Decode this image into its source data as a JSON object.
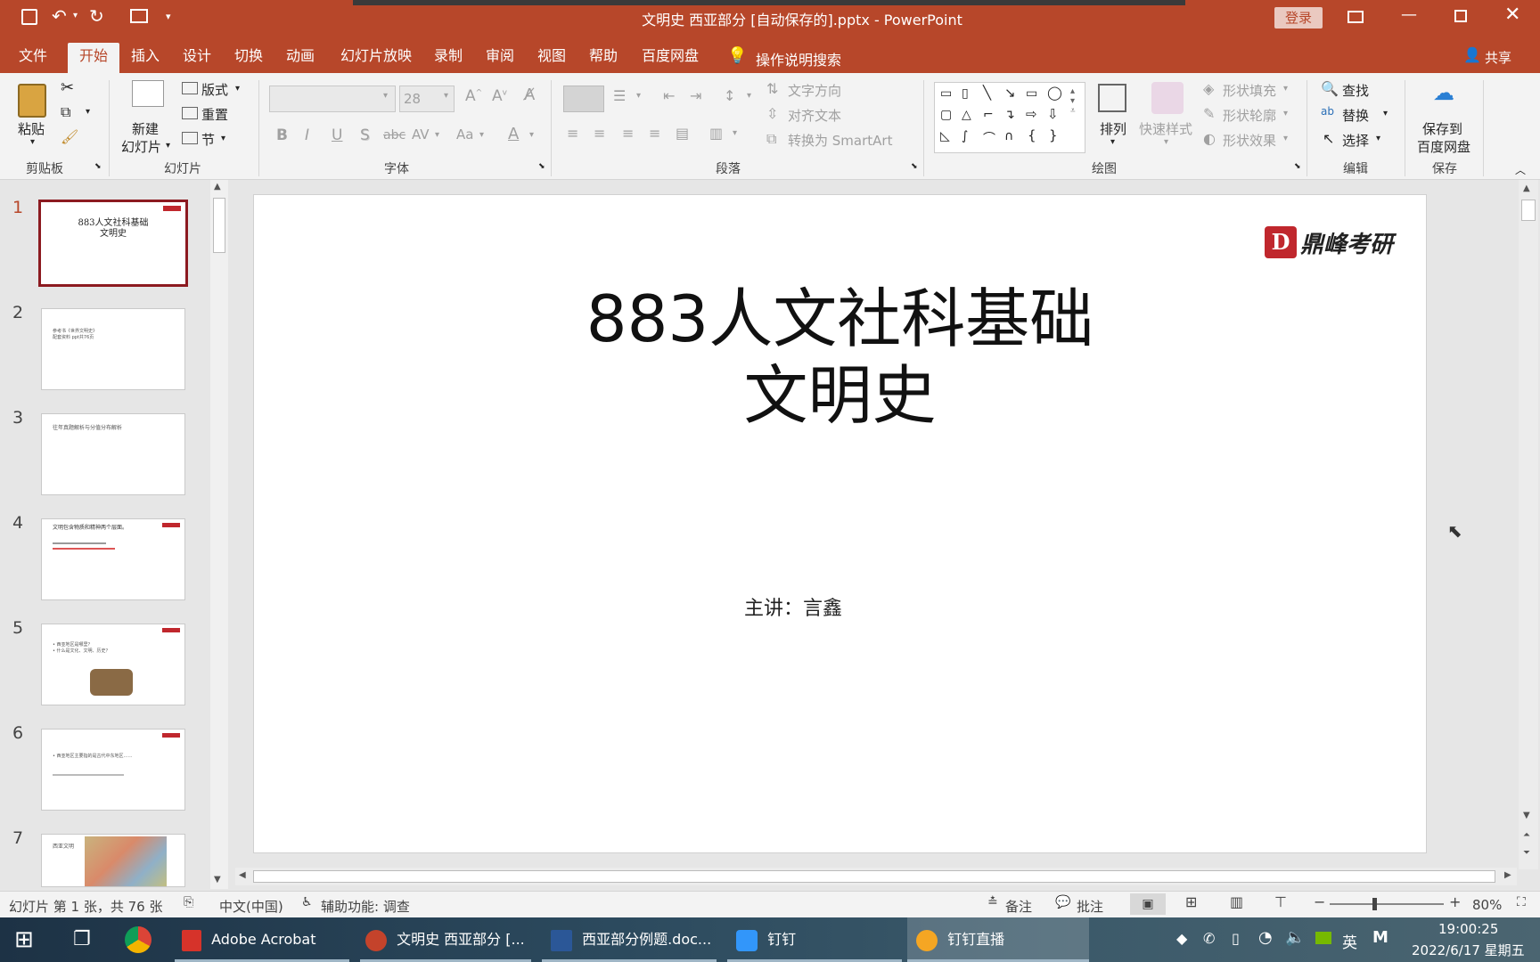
{
  "window": {
    "title": "文明史 西亚部分 [自动保存的].pptx - PowerPoint",
    "login": "登录"
  },
  "tabs": [
    "文件",
    "开始",
    "插入",
    "设计",
    "切换",
    "动画",
    "幻灯片放映",
    "录制",
    "审阅",
    "视图",
    "帮助",
    "百度网盘"
  ],
  "active_tab": "开始",
  "search_label": "操作说明搜索",
  "share_label": "共享",
  "ribbon": {
    "clipboard": {
      "paste": "粘贴",
      "label": "剪贴板"
    },
    "slides": {
      "new_slide_1": "新建",
      "new_slide_2": "幻灯片",
      "layout": "版式",
      "reset": "重置",
      "section": "节",
      "label": "幻灯片"
    },
    "font": {
      "size": "28",
      "bold": "B",
      "italic": "I",
      "underline": "U",
      "shadow": "S",
      "strike": "abc",
      "spacing": "AV",
      "case": "Aa",
      "color": "A",
      "label": "字体"
    },
    "paragraph": {
      "text_direction": "文字方向",
      "align_text": "对齐文本",
      "smartart": "转换为 SmartArt",
      "label": "段落"
    },
    "drawing": {
      "arrange": "排列",
      "quick_styles": "快速样式",
      "fill": "形状填充",
      "outline": "形状轮廓",
      "effects": "形状效果",
      "label": "绘图"
    },
    "editing": {
      "find": "查找",
      "replace": "替换",
      "select": "选择",
      "label": "编辑"
    },
    "save": {
      "line1": "保存到",
      "line2": "百度网盘",
      "label": "保存"
    }
  },
  "thumbnails": [
    {
      "num": "1",
      "lines": [
        "883人文社科基础",
        "文明史"
      ]
    },
    {
      "num": "2",
      "lines": [
        "参考书《世界文明史》",
        "配套资料 ppt共76页"
      ]
    },
    {
      "num": "3",
      "lines": [
        "往年真题解析与分值分布解析"
      ]
    },
    {
      "num": "4",
      "lines": [
        "文明包含物质和精神两个层面。"
      ]
    },
    {
      "num": "5",
      "lines": [
        "• 西亚地区是哪里？",
        "• 什么是文化、文明、历史？"
      ]
    },
    {
      "num": "6",
      "lines": [
        "• 西亚地区主要指的是古代中东地区……"
      ]
    },
    {
      "num": "7",
      "lines": [
        "西亚文明"
      ]
    }
  ],
  "slide": {
    "title_line1": "883人文社科基础",
    "title_line2": "文明史",
    "presenter": "主讲：言鑫",
    "logo_text": "鼎峰考研"
  },
  "status": {
    "slide_info": "幻灯片 第 1 张，共 76 张",
    "language": "中文(中国)",
    "accessibility": "辅助功能: 调查",
    "notes": "备注",
    "comments": "批注",
    "zoom": "80%"
  },
  "taskbar": {
    "items": [
      "Adobe Acrobat",
      "文明史 西亚部分 [...",
      "西亚部分例题.doc...",
      "钉钉",
      "钉钉直播"
    ],
    "ime": "英",
    "time": "19:00:25",
    "date": "2022/6/17 星期五"
  },
  "colors": {
    "accent": "#b7472a",
    "selected_thumb": "#8c1a20"
  }
}
